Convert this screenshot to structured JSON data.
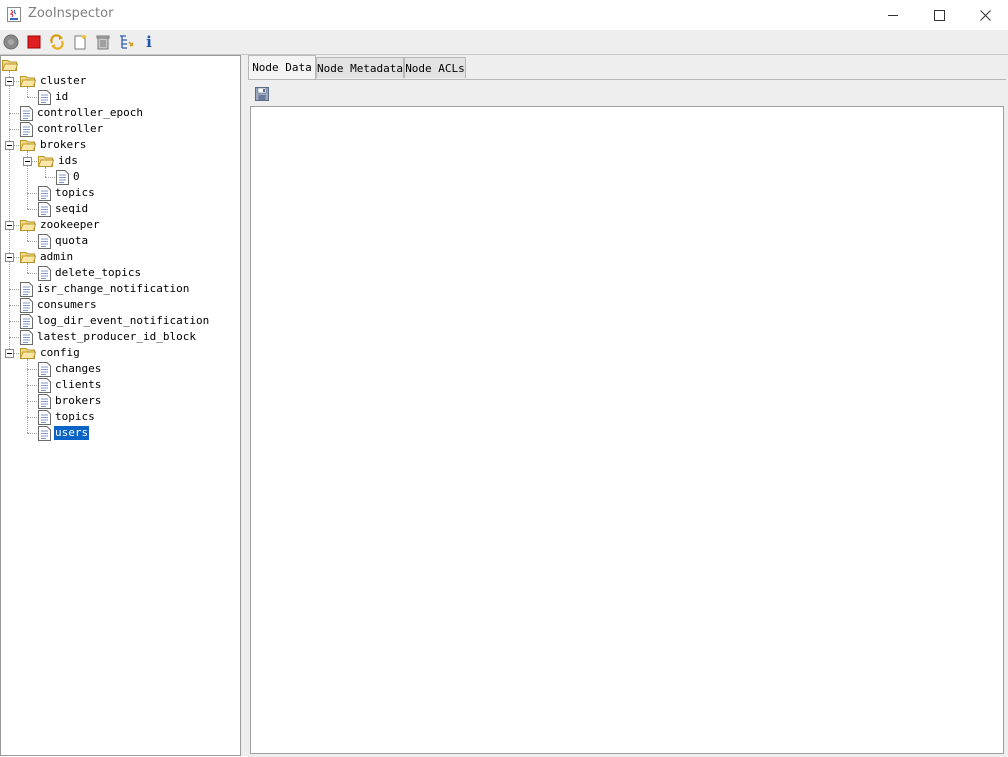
{
  "window": {
    "title": "ZooInspector"
  },
  "toolbar": {
    "buttons": [
      {
        "name": "connect-button",
        "icon": "connect-icon"
      },
      {
        "name": "disconnect-button",
        "icon": "stop-icon"
      },
      {
        "name": "refresh-button",
        "icon": "refresh-icon"
      },
      {
        "name": "add-node-button",
        "icon": "new-node-icon"
      },
      {
        "name": "delete-node-button",
        "icon": "trash-icon"
      },
      {
        "name": "node-viewers-button",
        "icon": "tree-settings-icon"
      },
      {
        "name": "about-button",
        "icon": "info-icon"
      }
    ]
  },
  "tree": {
    "nodes": [
      {
        "label": "cluster",
        "type": "folder",
        "depth": 1
      },
      {
        "label": "id",
        "type": "file",
        "depth": 2
      },
      {
        "label": "controller_epoch",
        "type": "file",
        "depth": 1
      },
      {
        "label": "controller",
        "type": "file",
        "depth": 1
      },
      {
        "label": "brokers",
        "type": "folder",
        "depth": 1
      },
      {
        "label": "ids",
        "type": "folder",
        "depth": 2
      },
      {
        "label": "0",
        "type": "file",
        "depth": 3
      },
      {
        "label": "topics",
        "type": "file",
        "depth": 2
      },
      {
        "label": "seqid",
        "type": "file",
        "depth": 2
      },
      {
        "label": "zookeeper",
        "type": "folder",
        "depth": 1
      },
      {
        "label": "quota",
        "type": "file",
        "depth": 2
      },
      {
        "label": "admin",
        "type": "folder",
        "depth": 1
      },
      {
        "label": "delete_topics",
        "type": "file",
        "depth": 2
      },
      {
        "label": "isr_change_notification",
        "type": "file",
        "depth": 1
      },
      {
        "label": "consumers",
        "type": "file",
        "depth": 1
      },
      {
        "label": "log_dir_event_notification",
        "type": "file",
        "depth": 1
      },
      {
        "label": "latest_producer_id_block",
        "type": "file",
        "depth": 1
      },
      {
        "label": "config",
        "type": "folder",
        "depth": 1
      },
      {
        "label": "changes",
        "type": "file",
        "depth": 2
      },
      {
        "label": "clients",
        "type": "file",
        "depth": 2
      },
      {
        "label": "brokers",
        "type": "file",
        "depth": 2
      },
      {
        "label": "topics",
        "type": "file",
        "depth": 2
      },
      {
        "label": "users",
        "type": "file",
        "depth": 2,
        "selected": true
      }
    ]
  },
  "tabs": [
    {
      "label": "Node Data",
      "active": true
    },
    {
      "label": "Node Metadata",
      "active": false
    },
    {
      "label": "Node ACLs",
      "active": false
    }
  ],
  "node_data": {
    "content": ""
  }
}
